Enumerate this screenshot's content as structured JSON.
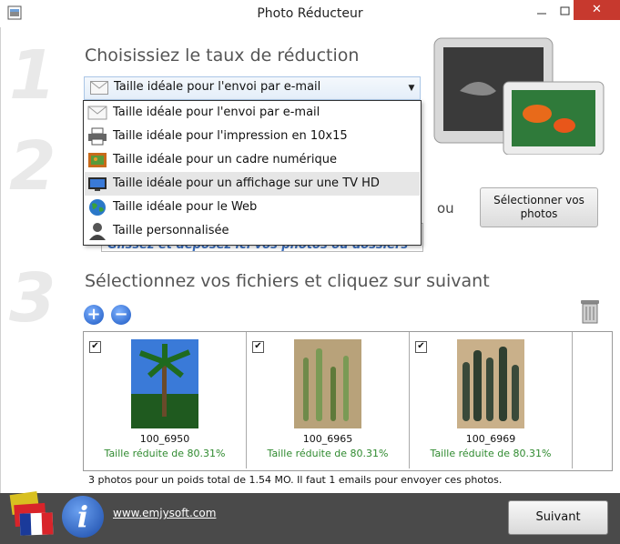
{
  "window": {
    "title": "Photo Réducteur",
    "close_glyph": "✕"
  },
  "steps": {
    "one": "1",
    "two": "2",
    "three": "3",
    "step1_title": "Choisissiez le taux de réduction",
    "step3_title": "Sélectionnez vos fichiers et cliquez sur suivant"
  },
  "combo": {
    "selected": "Taille idéale pour l'envoi par e-mail",
    "arrow": "▼"
  },
  "dropdown": {
    "items": [
      {
        "label": "Taille idéale pour l'envoi par e-mail",
        "icon": "envelope-icon"
      },
      {
        "label": "Taille idéale pour l'impression en 10x15",
        "icon": "printer-icon"
      },
      {
        "label": "Taille idéale pour un cadre numérique",
        "icon": "picture-frame-icon"
      },
      {
        "label": "Taille idéale pour un affichage sur une TV HD",
        "icon": "tv-icon"
      },
      {
        "label": "Taille idéale pour le Web",
        "icon": "globe-icon"
      },
      {
        "label": "Taille personnalisée",
        "icon": "person-icon"
      }
    ],
    "highlighted_index": 3
  },
  "step2": {
    "drop_hint": "Glissez et déposez ici vos photos ou dossiers",
    "or_label": "ou",
    "select_button_line1": "Sélectionner vos",
    "select_button_line2": "photos"
  },
  "toolbar": {
    "add_glyph": "+",
    "remove_glyph": "−"
  },
  "photos": [
    {
      "name": "100_6950",
      "reduction": "Taille réduite de 80.31%",
      "checked": "✔"
    },
    {
      "name": "100_6965",
      "reduction": "Taille réduite de 80.31%",
      "checked": "✔"
    },
    {
      "name": "100_6969",
      "reduction": "Taille réduite de 80.31%",
      "checked": "✔"
    }
  ],
  "summary": "3 photos pour un poids total de 1.54 MO. Il faut 1 emails pour envoyer ces photos.",
  "footer": {
    "link": "www.emjysoft.com",
    "info_glyph": "i",
    "next_label": "Suivant"
  },
  "colors": {
    "accent_blue": "#1a56c0",
    "success_green": "#2f8a2f",
    "footer_bg": "#4a4a4a",
    "close_red": "#c7392e"
  }
}
